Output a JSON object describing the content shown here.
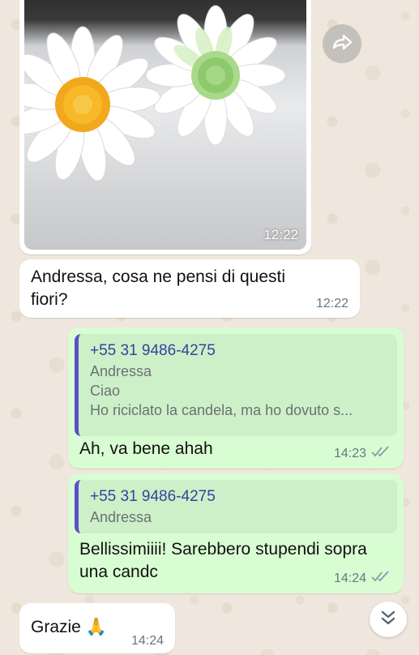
{
  "image_message": {
    "time": "12:22"
  },
  "text_message_1": {
    "text": "Andressa, cosa ne pensi di questi fiori?",
    "time": "12:22"
  },
  "reply_message_1": {
    "quote_sender": "+55 31 9486-4275",
    "quote_name": "Andressa",
    "quote_line1": "Ciao",
    "quote_line2": "Ho riciclato la candela, ma ho dovuto s...",
    "text": "Ah, va bene ahah",
    "time": "14:23"
  },
  "reply_message_2": {
    "quote_sender": "+55 31 9486-4275",
    "quote_name": "Andressa",
    "text": "Bellissimiiii! Sarebbero stupendi sopra una candᴄ",
    "time": "14:24"
  },
  "text_message_2": {
    "text": "Grazie 🙏",
    "time": "14:24"
  },
  "icons": {
    "forward": "forward-icon",
    "read_ticks": "double-check-icon",
    "scroll_down": "double-chevron-down-icon"
  },
  "colors": {
    "outgoing_bubble": "#d9fdd3",
    "incoming_bubble": "#ffffff",
    "quote_bar": "#5b4fc8",
    "read_tick": "#8a9aa3"
  }
}
